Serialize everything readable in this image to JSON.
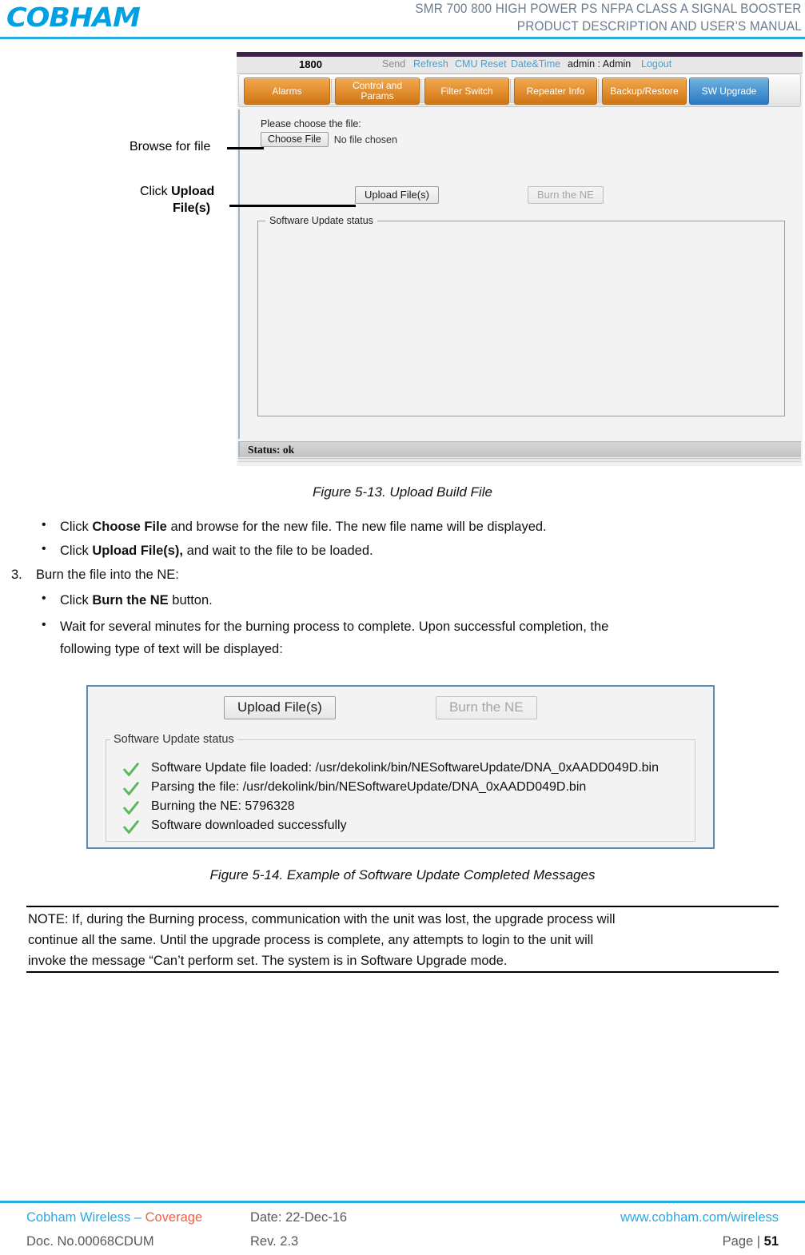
{
  "header": {
    "logo": "COBHAM",
    "title_line1": "SMR 700 800 HIGH POWER PS NFPA CLASS A SIGNAL BOOSTER",
    "title_line2": "PRODUCT DESCRIPTION AND USER’S MANUAL"
  },
  "figure513": {
    "toolbar": {
      "device_id": "1800",
      "send": "Send",
      "refresh": "Refresh",
      "cmu_reset": "CMU Reset",
      "date_time": "Date&Time",
      "user": "admin : Admin",
      "logout": "Logout"
    },
    "tabs": [
      {
        "label": "Alarms",
        "state": "inactive"
      },
      {
        "label": "Control and Params",
        "state": "inactive"
      },
      {
        "label": "Filter Switch",
        "state": "inactive"
      },
      {
        "label": "Repeater Info",
        "state": "inactive"
      },
      {
        "label": "Backup/Restore",
        "state": "inactive"
      },
      {
        "label": "SW Upgrade",
        "state": "active"
      }
    ],
    "choose_label": "Please choose the file:",
    "choose_file_button": "Choose File",
    "no_file_text": "No file chosen",
    "upload_button": "Upload File(s)",
    "burn_button": "Burn the NE",
    "status_legend": "Software Update status",
    "status_bar": "Status: ok",
    "colors": {
      "tab_active": "#2a79c2",
      "tab_inactive": "#cf7515",
      "titlebar": "#3b2248",
      "link": "#4a9fd4"
    }
  },
  "callouts": {
    "browse": "Browse for file",
    "click_upload_line1_prefix": "Click ",
    "click_upload_line1_bold": "Upload",
    "click_upload_line2_bold": "File(s)"
  },
  "caption513": "Figure 5-13. Upload Build File",
  "caption514": "Figure 5-14. Example of Software Update Completed Messages",
  "instructions": [
    {
      "type": "bullet",
      "segments": [
        {
          "text": "Click ",
          "bold": false
        },
        {
          "text": "Choose File",
          "bold": true
        },
        {
          "text": " and browse for the new file. The new file name will be displayed.",
          "bold": false
        }
      ]
    },
    {
      "type": "bullet",
      "segments": [
        {
          "text": "Click ",
          "bold": false
        },
        {
          "text": "Upload File(s),",
          "bold": true
        },
        {
          "text": " and wait to the file to be loaded.",
          "bold": false
        }
      ]
    },
    {
      "type": "numbered",
      "number": "3.",
      "segments": [
        {
          "text": "Burn the file into the NE:",
          "bold": false
        }
      ]
    },
    {
      "type": "bullet",
      "segments": [
        {
          "text": "Click ",
          "bold": false
        },
        {
          "text": "Burn the NE",
          "bold": true
        },
        {
          "text": " button.",
          "bold": false
        }
      ]
    },
    {
      "type": "bullet",
      "segments": [
        {
          "text": "Wait for several minutes for the burning process to complete. Upon successful completion, the",
          "bold": false
        }
      ]
    },
    {
      "type": "continuation",
      "segments": [
        {
          "text": "following type of text will be displayed:",
          "bold": false
        }
      ]
    }
  ],
  "figure514": {
    "upload_button": "Upload File(s)",
    "burn_button": "Burn the NE",
    "status_legend": "Software Update status",
    "messages": [
      "Software Update file loaded: /usr/dekolink/bin/NESoftwareUpdate/DNA_0xAADD049D.bin",
      "Parsing the file: /usr/dekolink/bin/NESoftwareUpdate/DNA_0xAADD049D.bin",
      "Burning the NE: 5796328",
      "Software downloaded successfully"
    ],
    "check_color": "#5cb85c",
    "border_color": "#5b8cb8"
  },
  "note": {
    "line1": "NOTE: If, during the Burning process, communication with the unit was lost, the upgrade process will",
    "line2": "continue all the same.  Until the upgrade process is complete, any attempts to login to the unit will",
    "line3": "invoke the message “Can’t perform set. The system is in Software Upgrade mode."
  },
  "footer": {
    "company_blue": "Cobham Wireless",
    "company_sep": " – ",
    "company_orange": "Coverage",
    "date": "Date: 22-Dec-16",
    "website": "www.cobham.com/wireless",
    "doc_no": "Doc. No.00068CDUM",
    "revision": "Rev. 2.3",
    "page_prefix": "Page | ",
    "page_number": "51"
  }
}
